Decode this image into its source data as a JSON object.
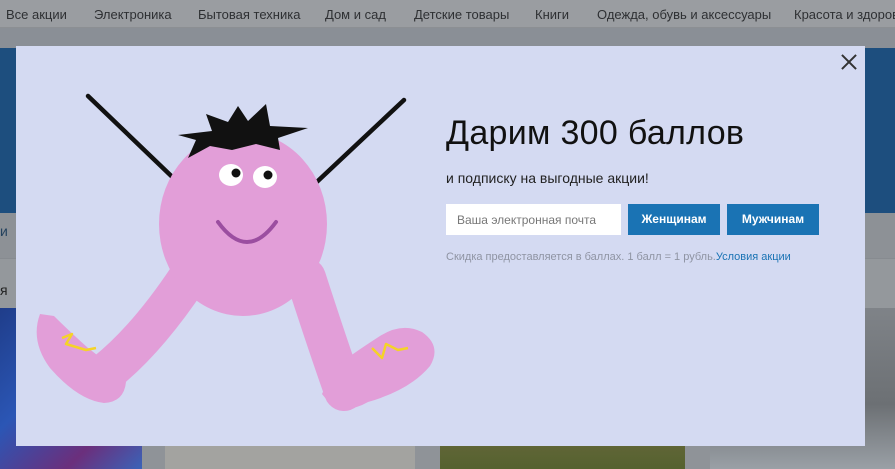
{
  "nav": {
    "items": [
      "Все акции",
      "Электроника",
      "Бытовая техника",
      "Дом и сад",
      "Детские товары",
      "Книги",
      "Одежда, обувь и аксессуары",
      "Красота и здоровье"
    ]
  },
  "background": {
    "strip_text": "и",
    "strip2_text": "я"
  },
  "modal": {
    "title": "Дарим 300 баллов",
    "subtitle": "и подписку на выгодные акции!",
    "email_placeholder": "Ваша электронная почта",
    "email_value": "",
    "women_button": "Женщинам",
    "men_button": "Мужчинам",
    "disclaimer": "Скидка предоставляется в баллах. 1 балл = 1 рубль.",
    "terms_link": "Условия акции",
    "close_icon": "close-icon",
    "mascot": "mascot-illustration"
  },
  "colors": {
    "modal_bg": "#d4daf2",
    "accent": "#1a73b4",
    "mascot_pink": "#e29ed8",
    "mascot_marks": "#f5d327"
  }
}
